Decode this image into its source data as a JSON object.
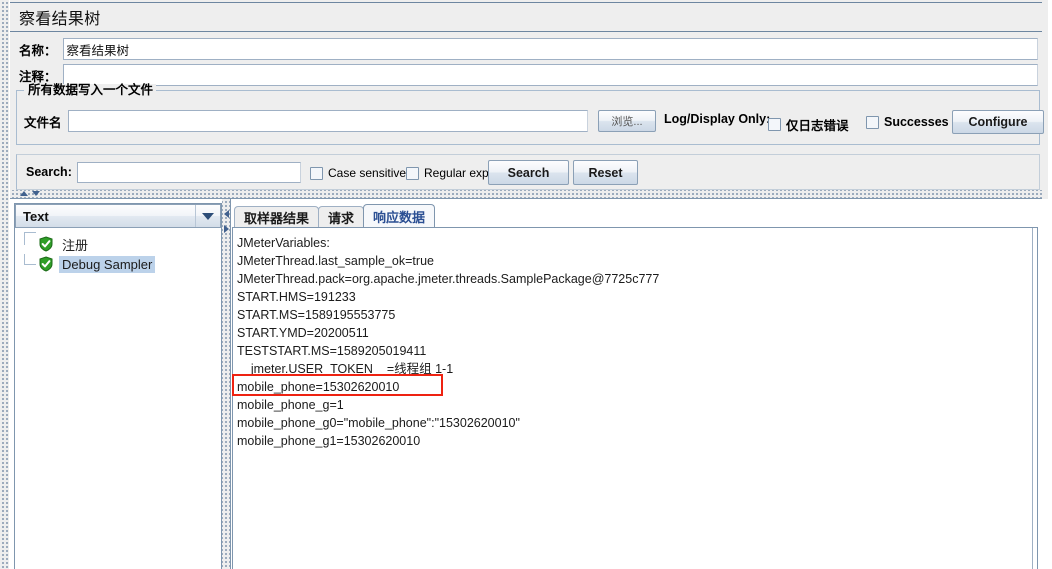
{
  "window": {
    "title": "察看结果树"
  },
  "form": {
    "name_label": "名称：",
    "name_value": "察看结果树",
    "comment_label": "注释：",
    "comment_value": ""
  },
  "file_group": {
    "title": "所有数据写入一个文件",
    "filename_label": "文件名",
    "filename_value": "",
    "browse_button": "浏览...",
    "log_display_only_label": "Log/Display Only:",
    "errors_checkbox": "仅日志错误",
    "successes_checkbox": "Successes",
    "configure_button": "Configure"
  },
  "search": {
    "label": "Search:",
    "value": "",
    "case_sensitive": "Case sensitive",
    "regular_exp": "Regular exp.",
    "search_button": "Search",
    "reset_button": "Reset"
  },
  "left_panel": {
    "renderer_selected": "Text",
    "tree": [
      {
        "label": "注册",
        "selected": false,
        "icon": "green-shield-check-icon"
      },
      {
        "label": "Debug Sampler",
        "selected": true,
        "icon": "green-shield-check-icon"
      }
    ]
  },
  "tabs": [
    {
      "label": "取样器结果",
      "active": false
    },
    {
      "label": "请求",
      "active": false
    },
    {
      "label": "响应数据",
      "active": true
    }
  ],
  "response_data": {
    "lines": [
      "JMeterVariables:",
      "JMeterThread.last_sample_ok=true",
      "JMeterThread.pack=org.apache.jmeter.threads.SamplePackage@7725c777",
      "START.HMS=191233",
      "START.MS=1589195553775",
      "START.YMD=20200511",
      "TESTSTART.MS=1589205019411",
      "    jmeter.USER_TOKEN__=线程组 1-1",
      "mobile_phone=15302620010",
      "mobile_phone_g=1",
      "mobile_phone_g0=\"mobile_phone\":\"15302620010\"",
      "mobile_phone_g1=15302620010"
    ],
    "highlighted_line_index": 8,
    "highlight_color": "#ee2211"
  },
  "colors": {
    "panel_bg": "#eeeeee",
    "border": "#7f96ae",
    "selection": "#bcd2ea",
    "active_tab_text": "#2b4f93",
    "shield_green": "#2f9e28"
  }
}
